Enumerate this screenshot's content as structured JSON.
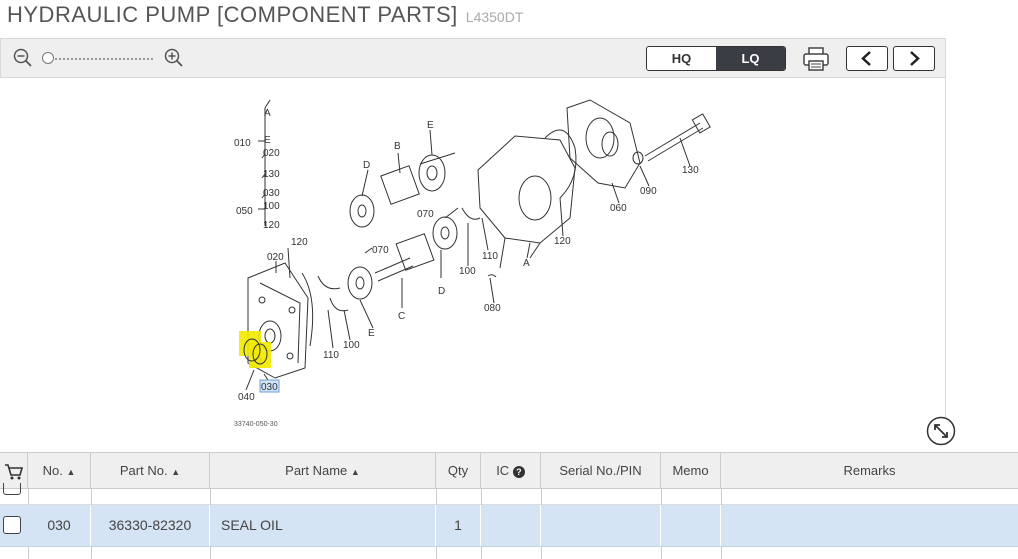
{
  "header": {
    "title": "HYDRAULIC PUMP [COMPONENT PARTS]",
    "model": "L4350DT"
  },
  "toolbar": {
    "zoom_out_icon": "zoom-out-icon",
    "zoom_in_icon": "zoom-in-icon",
    "zoom_level": 0,
    "quality_options": [
      "HQ",
      "LQ"
    ],
    "quality_selected": "LQ",
    "print_icon": "printer-icon",
    "prev_icon": "chevron-left-icon",
    "next_icon": "chevron-right-icon"
  },
  "diagram": {
    "left_labels": [
      "010",
      "A",
      "E",
      "020",
      "130",
      "030",
      "050",
      "100",
      "120"
    ],
    "callouts": [
      "120",
      "020",
      "070",
      "070",
      "D",
      "B",
      "E",
      "D",
      "E",
      "C",
      "110",
      "100",
      "110",
      "100",
      "080",
      "A",
      "120",
      "060",
      "090",
      "130",
      "030",
      "040"
    ],
    "highlighted_callout": "030",
    "figure_code": "33740-050-30",
    "expand_icon": "expand-icon"
  },
  "table": {
    "cart_icon": "cart-icon",
    "columns": [
      "No.",
      "Part No.",
      "Part Name",
      "Qty",
      "IC",
      "Serial No./PIN",
      "Memo",
      "Remarks"
    ],
    "rows": [
      {
        "no": "030",
        "part_no": "36330-82320",
        "part_name": "SEAL OIL",
        "qty": "1",
        "ic": "",
        "serial": "",
        "memo": "",
        "remarks": ""
      }
    ]
  },
  "colors": {
    "highlight": "#f2ea00",
    "selected_row": "#d4e4f4",
    "toolbar_bg": "#efefef",
    "active_toggle": "#3a3d44"
  }
}
